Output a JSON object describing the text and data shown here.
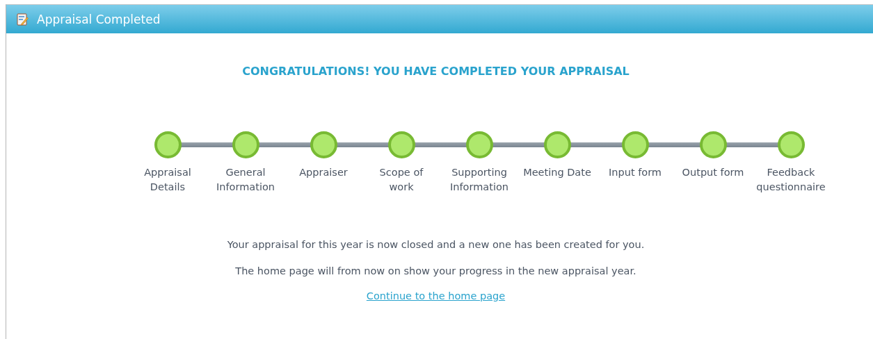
{
  "window": {
    "title": "Appraisal Completed"
  },
  "heading": "CONGRATULATIONS! YOU HAVE COMPLETED YOUR APPRAISAL",
  "steps": [
    {
      "label": "Appraisal\nDetails",
      "completed": true
    },
    {
      "label": "General\nInformation",
      "completed": true
    },
    {
      "label": "Appraiser",
      "completed": true
    },
    {
      "label": "Scope of\nwork",
      "completed": true
    },
    {
      "label": "Supporting\nInformation",
      "completed": true
    },
    {
      "label": "Meeting Date",
      "completed": true
    },
    {
      "label": "Input form",
      "completed": true
    },
    {
      "label": "Output form",
      "completed": true
    },
    {
      "label": "Feedback\nquestionnaire",
      "completed": true
    }
  ],
  "messages": [
    "Your appraisal for this year is now closed and a new one has been created for you.",
    "The home page will from now on show your progress in the new appraisal year."
  ],
  "link": "Continue to the home page"
}
